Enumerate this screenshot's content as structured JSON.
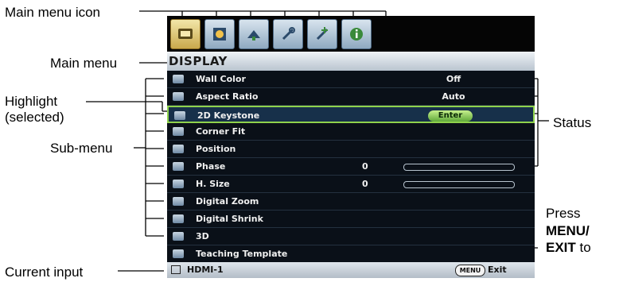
{
  "callouts": {
    "main_menu_icon": "Main menu icon",
    "main_menu": "Main menu",
    "highlight_line1": "Highlight",
    "highlight_line2": "(selected)",
    "sub_menu": "Sub-menu",
    "current_input": "Current input",
    "status": "Status",
    "press": "Press",
    "menu": "MENU/",
    "exit": "EXIT",
    "to": " to"
  },
  "osd": {
    "menu_title": "DISPLAY",
    "tabs": [
      {
        "icon": "display-tab-icon",
        "active": true
      },
      {
        "icon": "picture-tab-icon",
        "active": false
      },
      {
        "icon": "source-tab-icon",
        "active": false
      },
      {
        "icon": "system-setup-basic-tab-icon",
        "active": false
      },
      {
        "icon": "system-setup-advanced-tab-icon",
        "active": false
      },
      {
        "icon": "information-tab-icon",
        "active": false
      }
    ],
    "items": [
      {
        "label": "Wall Color",
        "value": "Off"
      },
      {
        "label": "Aspect Ratio",
        "value": "Auto"
      },
      {
        "label": "2D Keystone",
        "button": "Enter",
        "selected": true
      },
      {
        "label": "Corner Fit"
      },
      {
        "label": "Position"
      },
      {
        "label": "Phase",
        "number": "0",
        "level": 0
      },
      {
        "label": "H. Size",
        "number": "0",
        "level": 0
      },
      {
        "label": "Digital Zoom"
      },
      {
        "label": "Digital Shrink"
      },
      {
        "label": "3D"
      },
      {
        "label": "Teaching Template"
      }
    ],
    "status_bar": {
      "input_name": "HDMI-1",
      "menu_button": "MENU",
      "exit_label": "Exit"
    },
    "colors": {
      "highlight_border": "#8fd24c",
      "enter_button": "#7cc24a",
      "active_tab": "#e2c872"
    }
  }
}
